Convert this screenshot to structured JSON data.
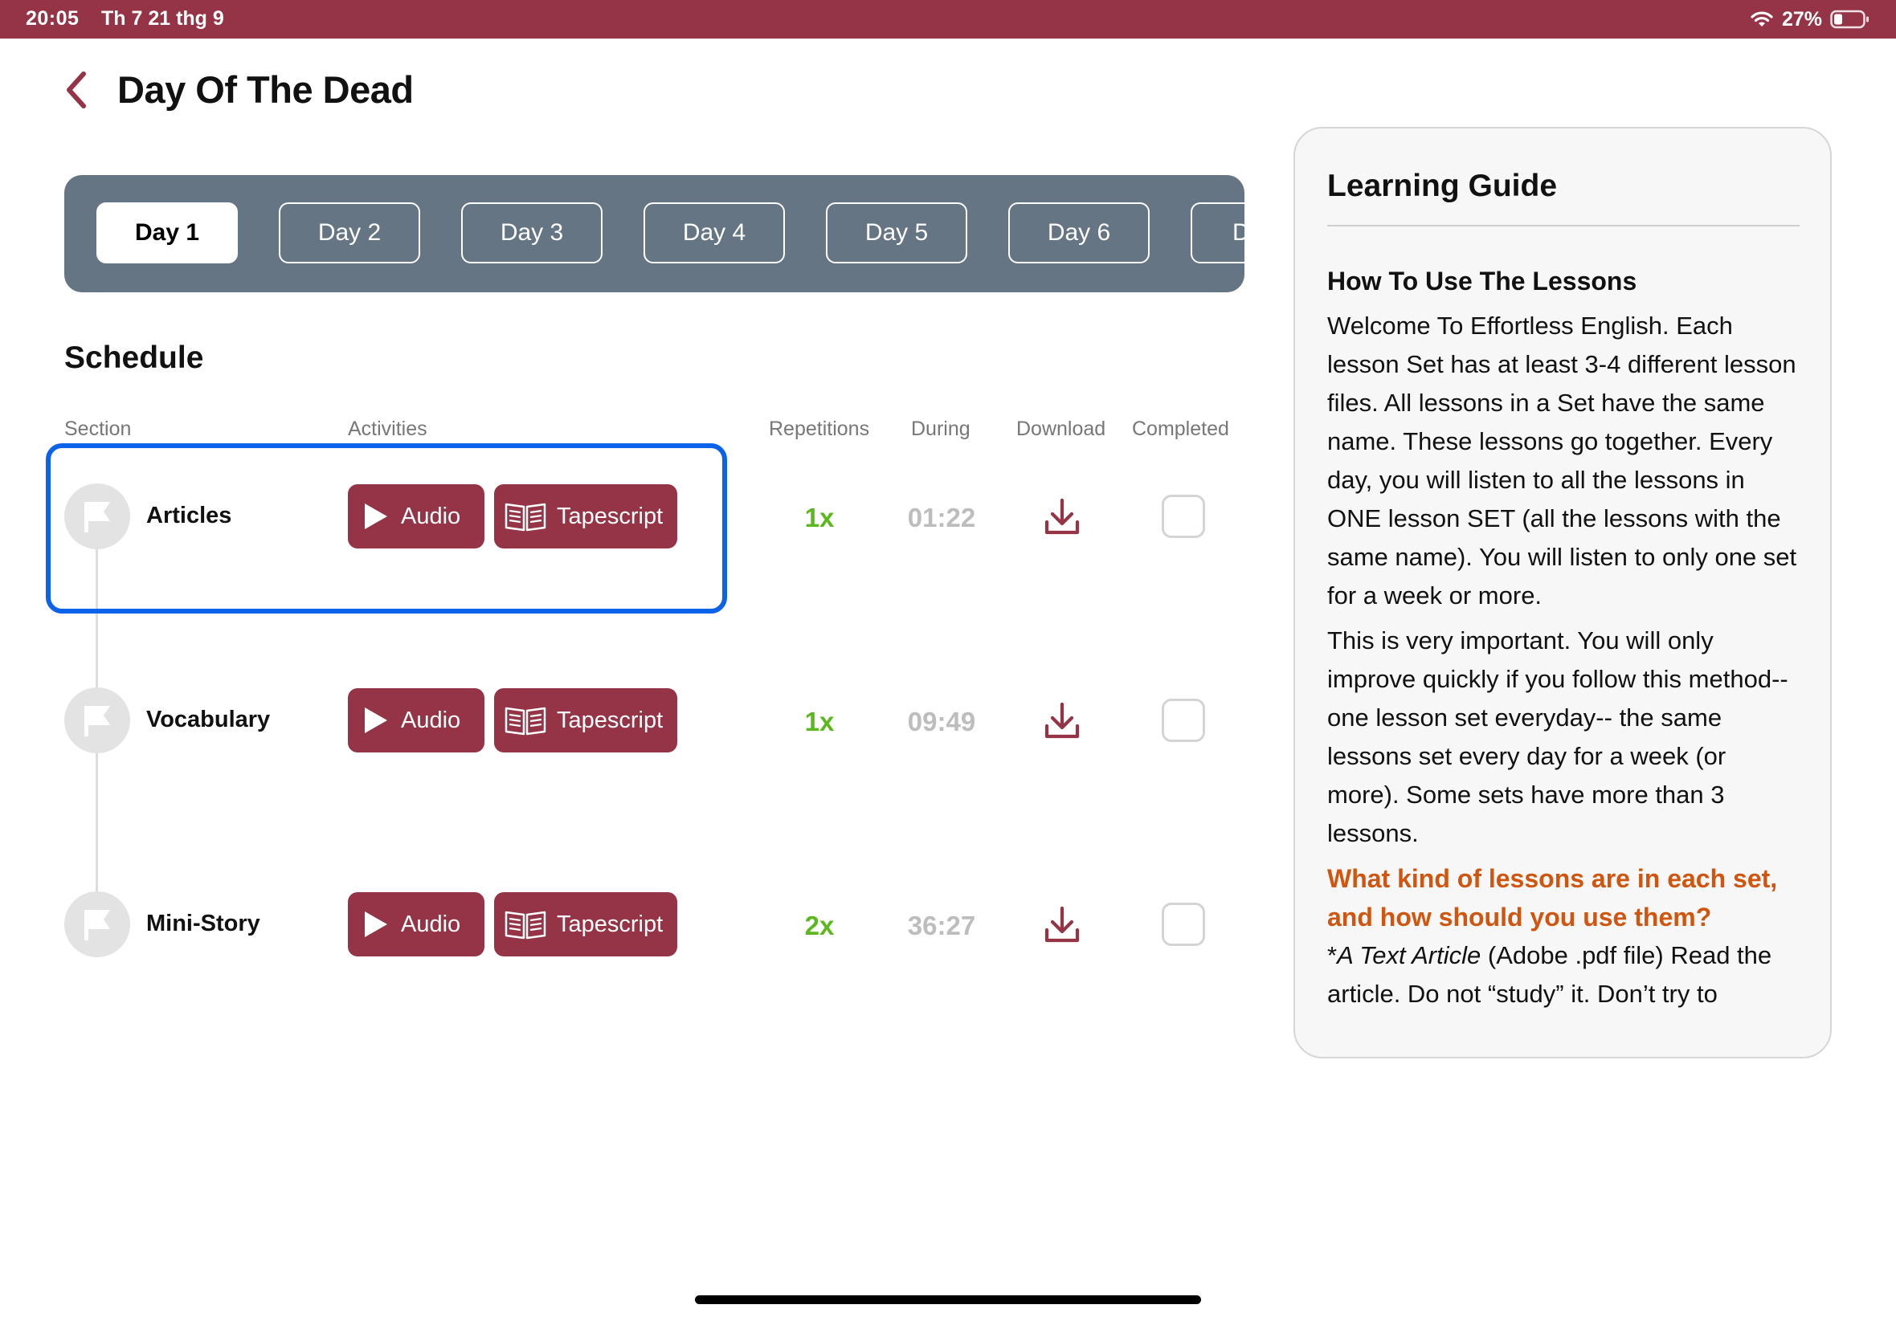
{
  "status_bar": {
    "time": "20:05",
    "date": "Th 7 21 thg 9",
    "battery": "27%",
    "color": "#943446"
  },
  "header": {
    "title": "Day Of The Dead",
    "back_icon": "chevron-left-icon"
  },
  "day_tabs": [
    {
      "label": "Day 1",
      "active": true
    },
    {
      "label": "Day 2",
      "active": false
    },
    {
      "label": "Day 3",
      "active": false
    },
    {
      "label": "Day 4",
      "active": false
    },
    {
      "label": "Day 5",
      "active": false
    },
    {
      "label": "Day 6",
      "active": false
    },
    {
      "label": "D",
      "active": false
    }
  ],
  "schedule": {
    "title": "Schedule",
    "columns": {
      "section": "Section",
      "activities": "Activities",
      "repetitions": "Repetitions",
      "during": "During",
      "download": "Download",
      "completed": "Completed"
    },
    "rows": [
      {
        "section": "Articles",
        "audio_label": "Audio",
        "tapescript_label": "Tapescript",
        "repetitions": "1x",
        "during": "01:22",
        "completed": false,
        "highlighted": true
      },
      {
        "section": "Vocabulary",
        "audio_label": "Audio",
        "tapescript_label": "Tapescript",
        "repetitions": "1x",
        "during": "09:49",
        "completed": false,
        "highlighted": false
      },
      {
        "section": "Mini-Story",
        "audio_label": "Audio",
        "tapescript_label": "Tapescript",
        "repetitions": "2x",
        "during": "36:27",
        "completed": false,
        "highlighted": false
      }
    ]
  },
  "learning_guide": {
    "title": "Learning Guide",
    "heading": "How To Use The Lessons",
    "paragraph1": "Welcome To Effortless English. Each lesson Set has at least 3-4 different lesson files. All lessons in a Set have the same name. These lessons go together. Every day, you will listen to all the lessons in ONE lesson SET (all the lessons with the same name). You will listen to only one set for a week or more.",
    "paragraph2": "This is very important. You will only improve quickly if you follow this method-- one lesson set everyday-- the same lessons set every day for a week (or more). Some sets have more than 3 lessons.",
    "question": "What kind of lessons are in each set, and how should you use them?",
    "article_prefix": "*",
    "article_title": "A Text Article",
    "article_text": " (Adobe .pdf file) Read the article. Do not “study” it. Don’t try to"
  },
  "colors": {
    "accent": "#943446",
    "tabs_bg": "#667583",
    "repetitions": "#5bb81f",
    "during": "#bdbdbd",
    "highlight": "#0a63e8",
    "question": "#d0550f"
  }
}
